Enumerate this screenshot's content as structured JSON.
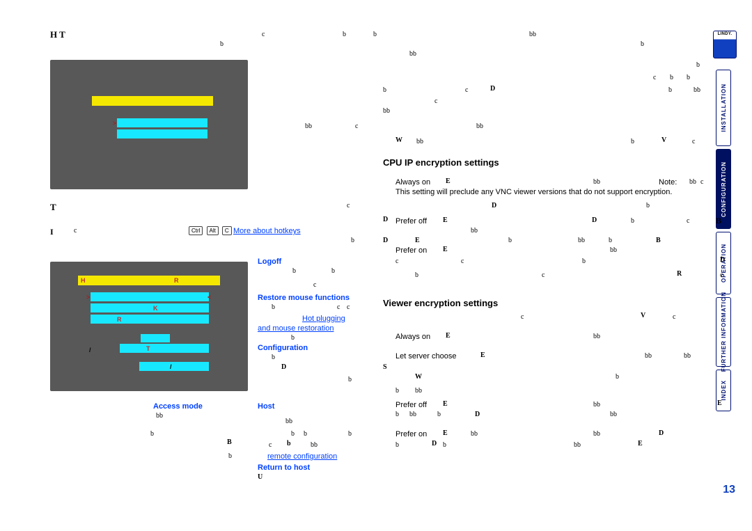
{
  "page_number": "13",
  "logo_text": "LINDY.",
  "right_tabs": [
    "INSTALLATION",
    "CONFIGURATION",
    "OPERATION",
    "FURTHER INFORMATION",
    "INDEX"
  ],
  "top_left_heading_glyphs": "H  T",
  "link_more_hotkeys": "More about hotkeys",
  "keycap_ctrl": "Ctrl",
  "keycap_alt": "Alt",
  "keycap_c": "C",
  "section_initial_letter_T": "T",
  "section_initial_letter_I": "I",
  "menu_items": {
    "logoff": "Logoff",
    "restore_mouse": "Restore mouse functions",
    "hot_plugging": "Hot plugging",
    "and_mouse_restoration": "and mouse restoration",
    "configuration": "Configuration",
    "access_mode": "Access mode",
    "host": "Host",
    "remote_configuration": "remote configuration",
    "return_to_host": "Return to host"
  },
  "screenshot2_labels": {
    "H": "H",
    "R": "R",
    "K": "K",
    "R2": "R",
    "slash1": "/",
    "T": "T",
    "slash2": "/"
  },
  "main": {
    "cpu_heading": "CPU IP encryption settings",
    "viewer_heading": "Viewer encryption settings",
    "always_on": "Always on",
    "prefer_off": "Prefer off",
    "prefer_on": "Prefer on",
    "let_server_choose": "Let server choose",
    "note_label": "Note:",
    "encryption_line": "This setting will preclude any VNC viewer versions that do not support encryption."
  },
  "scatter": {
    "D": "D",
    "E": "E",
    "B": "B",
    "V": "V",
    "W": "W",
    "S": "S",
    "U": "U",
    "R": "R",
    "b": "b",
    "bb": "bb",
    "c": "c"
  }
}
